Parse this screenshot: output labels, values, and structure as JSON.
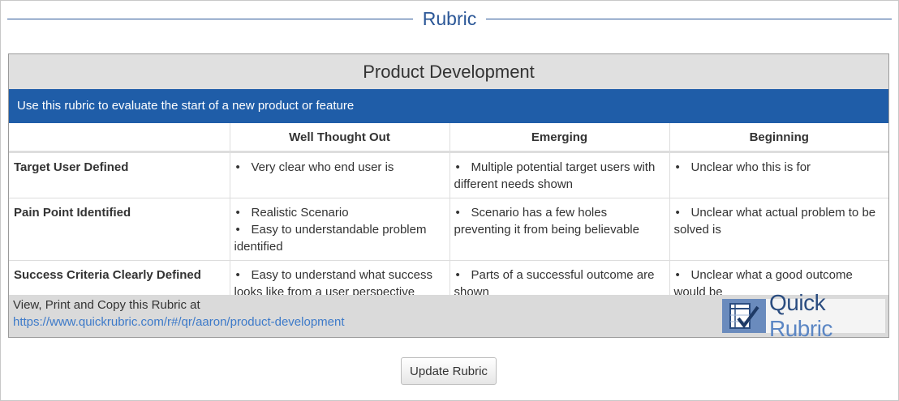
{
  "section_heading": "Rubric",
  "rubric": {
    "title": "Product Development",
    "description": "Use this rubric to evaluate the start of a new product or feature",
    "columns": [
      "",
      "Well Thought Out",
      "Emerging",
      "Beginning"
    ],
    "rows": [
      {
        "criterion": "Target User Defined",
        "cells": [
          [
            "Very clear who end user is"
          ],
          [
            "Multiple potential target users with different needs shown"
          ],
          [
            "Unclear who this is for"
          ]
        ]
      },
      {
        "criterion": "Pain Point Identified",
        "cells": [
          [
            "Realistic Scenario",
            "Easy to understandable problem identified"
          ],
          [
            "Scenario has a few holes preventing it from being believable"
          ],
          [
            "Unclear what actual problem to be solved is"
          ]
        ]
      },
      {
        "criterion": "Success Criteria Clearly Defined",
        "cells": [
          [
            "Easy to understand what success looks like from a user perspective"
          ],
          [
            "Parts of a successful outcome are shown"
          ],
          [
            "Unclear what a good outcome would be"
          ]
        ]
      }
    ],
    "footer": {
      "text": "View, Print and Copy this Rubric at",
      "link": "https://www.quickrubric.com/r#/qr/aaron/product-development"
    },
    "logo": {
      "word_1": "Quick",
      "word_2": "Rubric"
    }
  },
  "update_button": "Update Rubric",
  "colors": {
    "accent": "#2b5797",
    "banner": "#1f5da8",
    "link": "#3d7ac9"
  }
}
